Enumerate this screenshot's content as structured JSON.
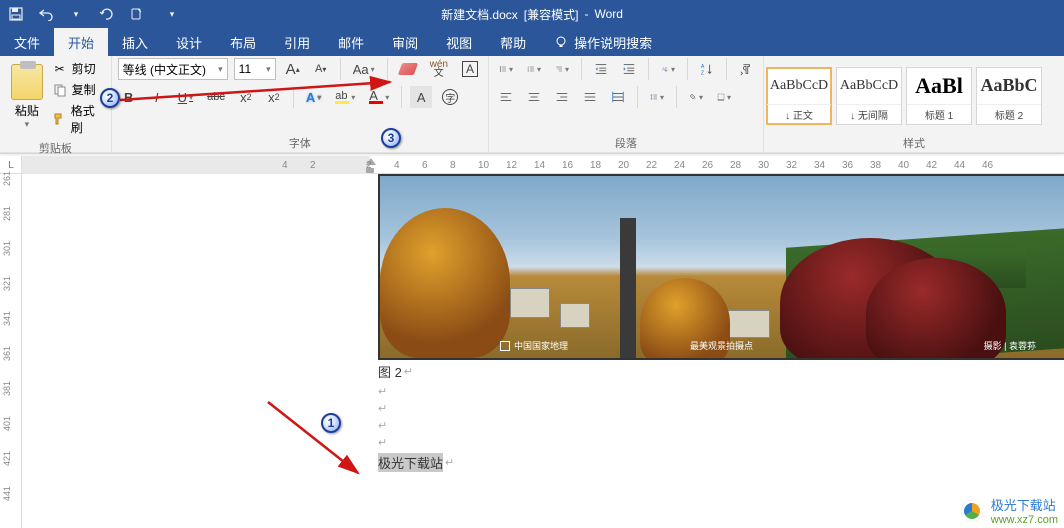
{
  "qat": {
    "tooltip_save": "保存",
    "tooltip_undo": "撤销",
    "tooltip_redo": "重做"
  },
  "title": {
    "doc": "新建文档.docx",
    "mode": "[兼容模式]",
    "sep": "-",
    "app": "Word"
  },
  "tabs": {
    "file": "文件",
    "home": "开始",
    "insert": "插入",
    "design": "设计",
    "layout": "布局",
    "references": "引用",
    "mailings": "邮件",
    "review": "审阅",
    "view": "视图",
    "help": "帮助",
    "tell": "操作说明搜索"
  },
  "clipboard": {
    "paste": "粘贴",
    "cut": "剪切",
    "copy": "复制",
    "format_painter": "格式刷",
    "group": "剪贴板"
  },
  "font": {
    "name": "等线 (中文正文)",
    "size": "11",
    "grow": "A",
    "shrink": "A",
    "changecase": "Aa",
    "phonetic_top": "wén",
    "phonetic_bottom": "文",
    "char_border": "A",
    "bold": "B",
    "italic": "I",
    "underline": "U",
    "strike": "abc",
    "sub": "x",
    "sub2": "2",
    "sup": "x",
    "sup2": "2",
    "text_effect": "A",
    "highlight": "ab",
    "fontcolor": "A",
    "char_shade": "A",
    "enclose": "字",
    "group": "字体"
  },
  "paragraph": {
    "group": "段落"
  },
  "styles": {
    "items": [
      {
        "preview": "AaBbCcD",
        "name": "↓ 正文"
      },
      {
        "preview": "AaBbCcD",
        "name": "↓ 无间隔"
      },
      {
        "preview": "AaBl",
        "name": "标题 1"
      },
      {
        "preview": "AaBbC",
        "name": "标题 2"
      }
    ],
    "group": "样式"
  },
  "ruler": {
    "corner": "L",
    "h": [
      "4",
      "2",
      "",
      "2",
      "4",
      "6",
      "8",
      "10",
      "12",
      "14",
      "16",
      "18",
      "20",
      "22",
      "24",
      "26",
      "28",
      "30",
      "32",
      "34",
      "36",
      "38",
      "40",
      "42",
      "44",
      "46"
    ],
    "v": [
      "261",
      "281",
      "301",
      "321",
      "341",
      "361",
      "381",
      "401",
      "421",
      "441"
    ]
  },
  "doc": {
    "img_caption_left": "中国国家地理",
    "img_caption_mid": "最美观景拍摄点",
    "img_caption_right": "摄影 | 袁蓉荪",
    "caption": "图 2",
    "selected": "极光下载站"
  },
  "anno": {
    "n1": "1",
    "n2": "2",
    "n3": "3"
  },
  "watermark": {
    "t1": "极光下载站",
    "t2": "www.xz7.com"
  }
}
